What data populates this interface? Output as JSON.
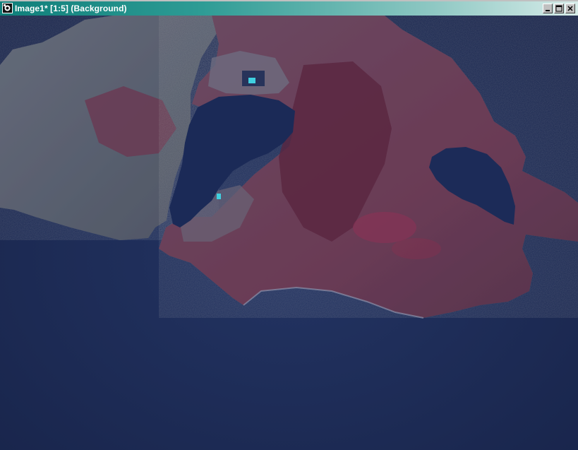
{
  "window": {
    "title": "Image1* [1:5] (Background)",
    "colors": {
      "titlebar_start": "#0f7f7a",
      "titlebar_end": "#d7ece9",
      "sea": "#1d2a4f",
      "land_west": "#5b6272",
      "vegetation": "#7a2f48",
      "lake": "#1b2a57",
      "salt_pond": "#40d0e0"
    }
  },
  "caption_buttons": [
    {
      "name": "minimize-button",
      "icon": "minimize-icon"
    },
    {
      "name": "maximize-button",
      "icon": "maximize-icon"
    },
    {
      "name": "close-button",
      "icon": "close-icon"
    }
  ],
  "image": {
    "description_icon": "satellite-image"
  }
}
